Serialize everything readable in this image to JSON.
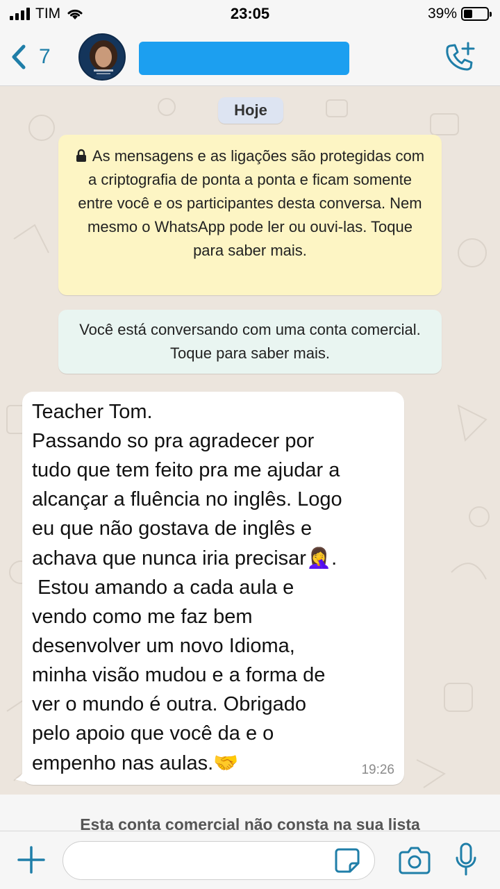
{
  "status_bar": {
    "carrier": "TIM",
    "time": "23:05",
    "battery_percent": "39%",
    "battery_level": 0.39
  },
  "header": {
    "back_count": "7"
  },
  "chat": {
    "date_label": "Hoje",
    "encryption_notice": "As mensagens e as ligações são protegidas com a criptografia de ponta a ponta e ficam somente entre você e os participantes desta conversa. Nem mesmo o WhatsApp pode ler ou ouvi-las. Toque para saber mais.",
    "business_notice": "Você está conversando com uma conta comercial. Toque para saber mais.",
    "messages": [
      {
        "text_lines": [
          "Teacher Tom.",
          "Passando so pra agradecer por",
          "tudo que tem feito pra me ajudar a",
          "alcançar a fluência no inglês. Logo",
          "eu que não gostava de inglês e",
          "achava que nunca iria precisar",
          " Estou amando a cada aula e",
          "vendo como me faz bem",
          "desenvolver um novo Idioma,",
          "minha visão mudou e a forma de",
          "ver o mundo é outra. Obrigado",
          "pelo apoio que você da e o",
          "empenho nas aulas."
        ],
        "emoji_facepalm": "🤦‍♀️",
        "line_end_dot": ".",
        "emoji_handshake": "🤝",
        "time": "19:26"
      }
    ]
  },
  "footer": {
    "business_contact_notice": "Esta conta comercial não consta na sua lista"
  },
  "input_bar": {
    "message_value": "",
    "message_placeholder": ""
  },
  "colors": {
    "accent": "#1f7ea8",
    "encryption_bg": "#fdf5c4",
    "business_bg": "#e9f5f1",
    "chat_bg": "#ece5dd",
    "redaction": "#1c9ff0"
  }
}
